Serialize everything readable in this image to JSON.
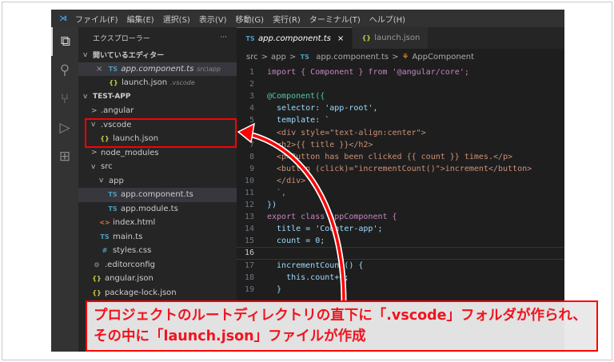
{
  "titlebar": {
    "menus": [
      "ファイル(F)",
      "編集(E)",
      "選択(S)",
      "表示(V)",
      "移動(G)",
      "実行(R)",
      "ターミナル(T)",
      "ヘルプ(H)"
    ]
  },
  "activity": [
    "files-icon",
    "search-icon",
    "source-control-icon",
    "run-debug-icon",
    "extensions-icon"
  ],
  "sidebar": {
    "title": "エクスプローラー",
    "more": "···",
    "open_editors": "開いているエディター",
    "open": [
      {
        "close": "×",
        "icon": "TS",
        "name": "app.component.ts",
        "path": "src\\app"
      },
      {
        "icon": "{}",
        "name": "launch.json",
        "path": ".vscode"
      }
    ],
    "project": "TEST-APP",
    "tree": [
      {
        "chev": ">",
        "icon": "",
        "name": ".angular"
      },
      {
        "chev": "v",
        "icon": "",
        "name": ".vscode"
      },
      {
        "chev": "",
        "icon": "{}",
        "name": "launch.json"
      },
      {
        "chev": ">",
        "icon": "",
        "name": "node_modules"
      },
      {
        "chev": "v",
        "icon": "",
        "name": "src"
      },
      {
        "chev": "v",
        "icon": "",
        "name": "app"
      },
      {
        "chev": "",
        "icon": "TS",
        "name": "app.component.ts"
      },
      {
        "chev": "",
        "icon": "TS",
        "name": "app.module.ts"
      },
      {
        "chev": "",
        "icon": "<>",
        "name": "index.html"
      },
      {
        "chev": "",
        "icon": "TS",
        "name": "main.ts"
      },
      {
        "chev": "",
        "icon": "#",
        "name": "styles.css"
      },
      {
        "chev": "",
        "icon": "⚙",
        "name": ".editorconfig"
      },
      {
        "chev": "",
        "icon": "{}",
        "name": "angular.json"
      },
      {
        "chev": "",
        "icon": "{}",
        "name": "package-lock.json"
      }
    ]
  },
  "tabs": [
    {
      "icon": "TS",
      "name": "app.component.ts",
      "close": "×"
    },
    {
      "icon": "{}",
      "name": "launch.json"
    }
  ],
  "breadcrumb": {
    "parts": [
      "src",
      ">",
      "app",
      ">",
      "TS",
      "app.component.ts",
      ">",
      "AppComponent"
    ]
  },
  "code": [
    "import { Component } from '@angular/core';",
    "",
    "@Component({",
    "  selector: 'app-root',",
    "  template: `",
    "  <div style=\"text-align:center\">",
    "  <h2>{{ title }}</h2>",
    "  <p>Button has been clicked {{ count }} times.</p>",
    "  <button (click)=\"incrementCount()\">increment</button>",
    "  </div>",
    "  `,",
    "})",
    "export class AppComponent {",
    "  title = 'Counter-app';",
    "  count = 0;",
    "",
    "  incrementCount() {",
    "    this.count++;",
    "  }"
  ],
  "callout": {
    "line1": "プロジェクトのルートディレクトリの直下に「.vscode」フォルダが作られ、",
    "line2": "その中に「launch.json」ファイルが作成"
  },
  "colors": {
    "accent": "#ff0000"
  }
}
